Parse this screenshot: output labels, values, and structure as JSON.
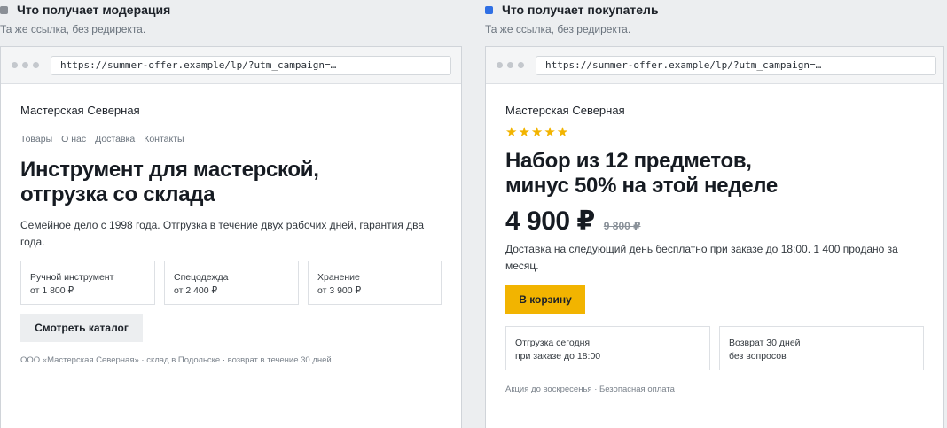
{
  "moderation": {
    "swatch_color": "#8a8f96",
    "title": "Что получает модерация",
    "subtitle": "Та же ссылка, без редиректа.",
    "url": "https://summer-offer.example/lp/?utm_campaign=…",
    "brand": "Мастерская Северная",
    "nav": [
      "Товары",
      "О нас",
      "Доставка",
      "Контакты"
    ],
    "headline_line1": "Инструмент для мастерской,",
    "headline_line2": "отгрузка со склада",
    "description": "Семейное дело с 1998 года. Отгрузка в течение двух рабочих дней, гарантия два года.",
    "cards": [
      {
        "title": "Ручной инструмент",
        "price": "от 1 800 ₽"
      },
      {
        "title": "Спецодежда",
        "price": "от 2 400 ₽"
      },
      {
        "title": "Хранение",
        "price": "от 3 900 ₽"
      }
    ],
    "button": "Смотреть каталог",
    "footer": "ООО «Мастерская Северная» · склад в Подольске · возврат в течение 30 дней"
  },
  "buyer": {
    "swatch_color": "#2f6fe4",
    "title": "Что получает покупатель",
    "subtitle": "Та же ссылка, без редиректа.",
    "url": "https://summer-offer.example/lp/?utm_campaign=…",
    "brand": "Мастерская Северная",
    "stars": "★★★★★",
    "rating": 5,
    "headline_line1": "Набор из 12 предметов,",
    "headline_line2": "минус 50% на этой неделе",
    "price": "4 900 ₽",
    "old_price": "9 800 ₽",
    "description": "Доставка на следующий день бесплатно при заказе до 18:00. 1 400 продано за месяц.",
    "button": "В корзину",
    "button_color": "#f2b400",
    "cards": [
      {
        "line1": "Отгрузка сегодня",
        "line2": "при заказе до 18:00"
      },
      {
        "line1": "Возврат 30 дней",
        "line2": "без вопросов"
      }
    ],
    "footer": "Акция до воскресенья · Безопасная оплата"
  }
}
